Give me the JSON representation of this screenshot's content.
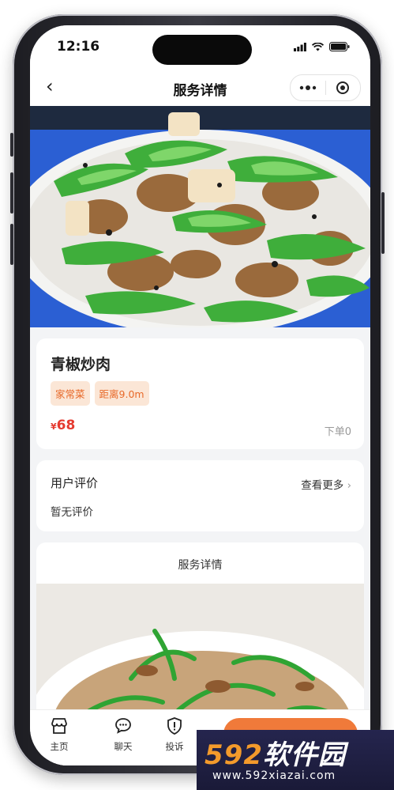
{
  "status": {
    "time": "12:16"
  },
  "nav": {
    "back": "‹",
    "title": "服务详情"
  },
  "dish": {
    "name": "青椒炒肉",
    "tags": [
      "家常菜",
      "距离9.0m"
    ],
    "price_symbol": "¥",
    "price": "68",
    "orders": "下单0"
  },
  "reviews": {
    "title": "用户评价",
    "more": "查看更多",
    "more_arrow": "›",
    "empty": "暂无评价"
  },
  "detail": {
    "title": "服务详情"
  },
  "tabbar": {
    "items": [
      {
        "label": "主页",
        "icon": "shop-icon"
      },
      {
        "label": "聊天",
        "icon": "chat-icon"
      },
      {
        "label": "投诉",
        "icon": "report-icon"
      }
    ]
  },
  "watermark": {
    "brand_num": "592",
    "brand_text": "软件园",
    "url": "www.592xiazai.com"
  },
  "colors": {
    "accent": "#e86a2a",
    "price": "#e53a2f",
    "order_button": "#f07a3a",
    "plate_blue": "#2b5fd3"
  }
}
